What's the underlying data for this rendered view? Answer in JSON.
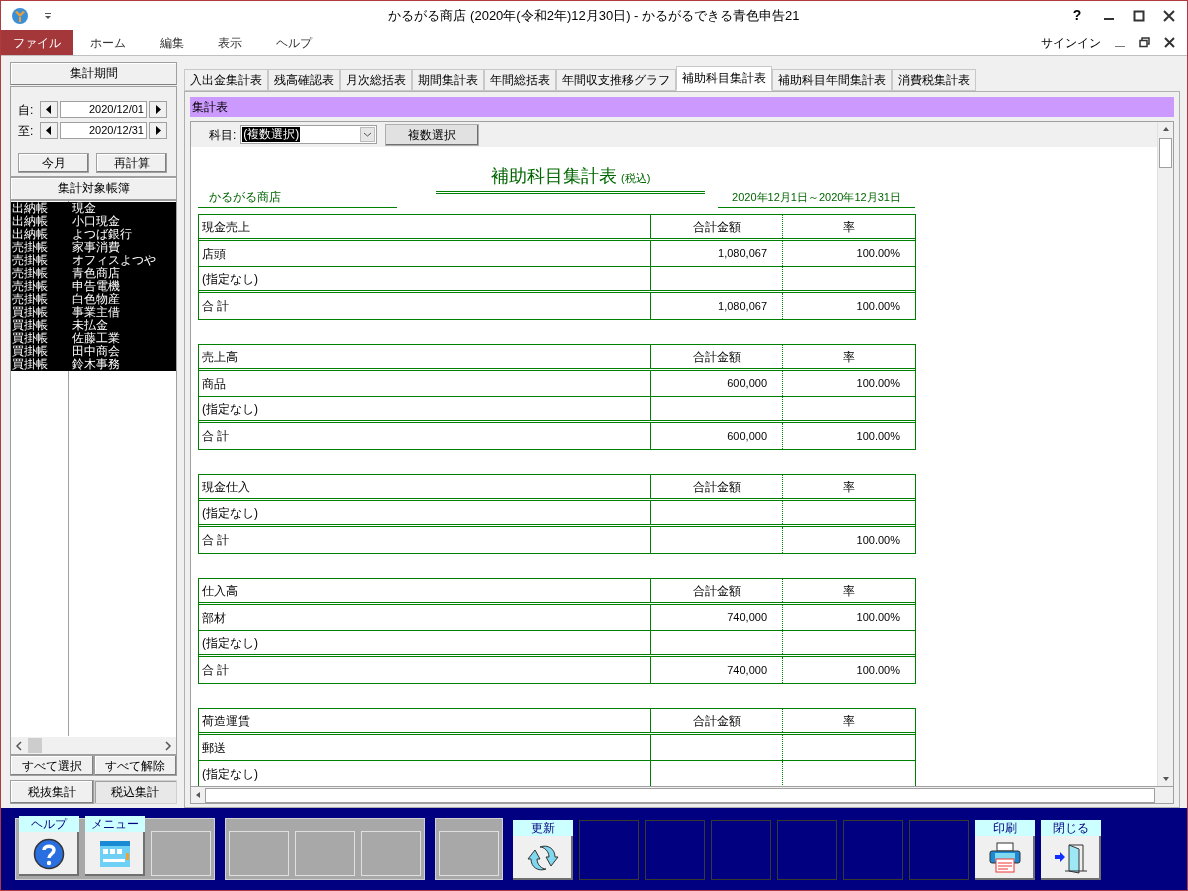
{
  "window": {
    "title": "かるがる商店 (2020年(令和2年)12月30日) - かるがるできる青色申告21",
    "help": "?"
  },
  "menu": {
    "items": [
      {
        "label": "ファイル",
        "selected": true
      },
      {
        "label": "ホーム",
        "selected": false
      },
      {
        "label": "編集",
        "selected": false
      },
      {
        "label": "表示",
        "selected": false
      },
      {
        "label": "ヘルプ",
        "selected": false
      }
    ],
    "signin": "サインイン"
  },
  "left": {
    "period_header": "集計期間",
    "from_label": "自:",
    "from_date": "2020/12/01",
    "to_label": "至:",
    "to_date": "2020/12/31",
    "buttons": [
      "今月",
      "再計算"
    ],
    "books_header": "集計対象帳簿",
    "books": [
      {
        "type": "出納帳",
        "name": "現金",
        "selected": true
      },
      {
        "type": "出納帳",
        "name": "小口現金",
        "selected": true
      },
      {
        "type": "出納帳",
        "name": "よつば銀行",
        "selected": true
      },
      {
        "type": "売掛帳",
        "name": "家事消費",
        "selected": true
      },
      {
        "type": "売掛帳",
        "name": "オフィスよつや",
        "selected": true
      },
      {
        "type": "売掛帳",
        "name": "青色商店",
        "selected": true
      },
      {
        "type": "売掛帳",
        "name": "申告電機",
        "selected": true
      },
      {
        "type": "売掛帳",
        "name": "白色物産",
        "selected": true
      },
      {
        "type": "買掛帳",
        "name": "事業主借",
        "selected": true
      },
      {
        "type": "買掛帳",
        "name": "未払金",
        "selected": true
      },
      {
        "type": "買掛帳",
        "name": "佐藤工業",
        "selected": true
      },
      {
        "type": "買掛帳",
        "name": "田中商会",
        "selected": true
      },
      {
        "type": "買掛帳",
        "name": "鈴木事務",
        "selected": true
      }
    ],
    "select_buttons": [
      "すべて選択",
      "すべて解除"
    ],
    "tax_modes": [
      {
        "label": "税抜集計",
        "selected": false
      },
      {
        "label": "税込集計",
        "selected": true
      }
    ]
  },
  "tabs": [
    {
      "label": "入出金集計表",
      "selected": false
    },
    {
      "label": "残高確認表",
      "selected": false
    },
    {
      "label": "月次総括表",
      "selected": false
    },
    {
      "label": "期間集計表",
      "selected": false
    },
    {
      "label": "年間総括表",
      "selected": false
    },
    {
      "label": "年間収支推移グラフ",
      "selected": false
    },
    {
      "label": "補助科目集計表",
      "selected": true
    },
    {
      "label": "補助科目年間集計表",
      "selected": false
    },
    {
      "label": "消費税集計表",
      "selected": false
    }
  ],
  "panel_title": "集計表",
  "filter": {
    "label": "科目:",
    "value": "(複数選択)",
    "button": "複数選択"
  },
  "report": {
    "title": "補助科目集計表",
    "title_note": "(税込)",
    "company": "かるがる商店",
    "period": "2020年12月1日～2020年12月31日",
    "sections": [
      {
        "title": "現金売上",
        "amount_header": "合計金額",
        "rate_header": "率",
        "rows": [
          {
            "label": "店頭",
            "amount": "1,080,067",
            "rate": "100.00%"
          },
          {
            "label": "(指定なし)"
          }
        ],
        "total": {
          "label": "合 計",
          "amount": "1,080,067",
          "rate": "100.00%"
        }
      },
      {
        "title": "売上高",
        "amount_header": "合計金額",
        "rate_header": "率",
        "rows": [
          {
            "label": "商品",
            "amount": "600,000",
            "rate": "100.00%"
          },
          {
            "label": "(指定なし)"
          }
        ],
        "total": {
          "label": "合 計",
          "amount": "600,000",
          "rate": "100.00%"
        }
      },
      {
        "title": "現金仕入",
        "amount_header": "合計金額",
        "rate_header": "率",
        "rows": [
          {
            "label": "(指定なし)"
          }
        ],
        "total": {
          "label": "合 計",
          "rate": "100.00%"
        }
      },
      {
        "title": "仕入高",
        "amount_header": "合計金額",
        "rate_header": "率",
        "rows": [
          {
            "label": "部材",
            "amount": "740,000",
            "rate": "100.00%"
          },
          {
            "label": "(指定なし)"
          }
        ],
        "total": {
          "label": "合 計",
          "amount": "740,000",
          "rate": "100.00%"
        }
      },
      {
        "title": "荷造運賃",
        "amount_header": "合計金額",
        "rate_header": "率",
        "rows": [
          {
            "label": "郵送"
          },
          {
            "label": "(指定なし)"
          }
        ]
      }
    ]
  },
  "toolbar": [
    {
      "kind": "panel",
      "items": [
        {
          "kind": "help",
          "label": "ヘルプ"
        },
        {
          "kind": "menu",
          "label": "メニュー"
        },
        {
          "kind": "slot"
        }
      ]
    },
    {
      "kind": "panel",
      "items": [
        {
          "kind": "slot"
        },
        {
          "kind": "slot"
        },
        {
          "kind": "slot"
        }
      ]
    },
    {
      "kind": "panel",
      "items": [
        {
          "kind": "slot"
        }
      ]
    },
    {
      "kind": "free",
      "items": [
        {
          "kind": "refresh",
          "label": "更新"
        },
        {
          "kind": "empty"
        },
        {
          "kind": "empty"
        },
        {
          "kind": "empty"
        },
        {
          "kind": "empty"
        },
        {
          "kind": "empty"
        },
        {
          "kind": "empty"
        },
        {
          "kind": "print",
          "label": "印刷"
        },
        {
          "kind": "exit",
          "label": "閉じる"
        }
      ]
    }
  ]
}
